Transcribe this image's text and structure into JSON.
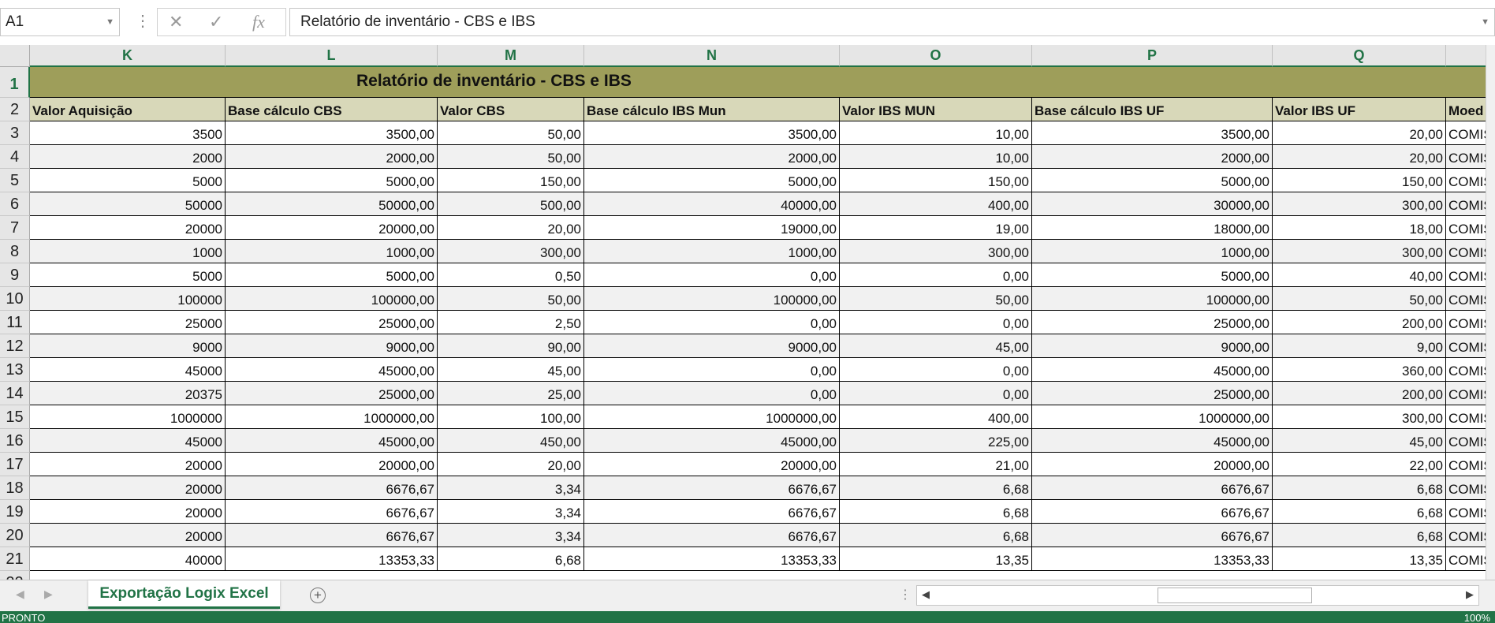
{
  "formula_bar": {
    "name_box": "A1",
    "cancel_icon": "✕",
    "enter_icon": "✓",
    "fx_label": "fx",
    "formula": "Relatório de inventário - CBS e IBS"
  },
  "columns": [
    "K",
    "L",
    "M",
    "N",
    "O",
    "P",
    "Q",
    ""
  ],
  "title": "Relatório de inventário - CBS e IBS",
  "headers": [
    "Valor Aquisição",
    "Base cálculo CBS",
    "Valor CBS",
    "Base cálculo IBS Mun",
    "Valor IBS MUN",
    "Base cálculo IBS UF",
    "Valor IBS UF",
    "Moed"
  ],
  "rows": [
    [
      "3500",
      "3500,00",
      "50,00",
      "3500,00",
      "10,00",
      "3500,00",
      "20,00",
      "COMIS"
    ],
    [
      "2000",
      "2000,00",
      "50,00",
      "2000,00",
      "10,00",
      "2000,00",
      "20,00",
      "COMIS"
    ],
    [
      "5000",
      "5000,00",
      "150,00",
      "5000,00",
      "150,00",
      "5000,00",
      "150,00",
      "COMIS"
    ],
    [
      "50000",
      "50000,00",
      "500,00",
      "40000,00",
      "400,00",
      "30000,00",
      "300,00",
      "COMIS"
    ],
    [
      "20000",
      "20000,00",
      "20,00",
      "19000,00",
      "19,00",
      "18000,00",
      "18,00",
      "COMIS"
    ],
    [
      "1000",
      "1000,00",
      "300,00",
      "1000,00",
      "300,00",
      "1000,00",
      "300,00",
      "COMIS"
    ],
    [
      "5000",
      "5000,00",
      "0,50",
      "0,00",
      "0,00",
      "5000,00",
      "40,00",
      "COMIS"
    ],
    [
      "100000",
      "100000,00",
      "50,00",
      "100000,00",
      "50,00",
      "100000,00",
      "50,00",
      "COMIS"
    ],
    [
      "25000",
      "25000,00",
      "2,50",
      "0,00",
      "0,00",
      "25000,00",
      "200,00",
      "COMIS"
    ],
    [
      "9000",
      "9000,00",
      "90,00",
      "9000,00",
      "45,00",
      "9000,00",
      "9,00",
      "COMIS"
    ],
    [
      "45000",
      "45000,00",
      "45,00",
      "0,00",
      "0,00",
      "45000,00",
      "360,00",
      "COMIS"
    ],
    [
      "20375",
      "25000,00",
      "25,00",
      "0,00",
      "0,00",
      "25000,00",
      "200,00",
      "COMIS"
    ],
    [
      "1000000",
      "1000000,00",
      "100,00",
      "1000000,00",
      "400,00",
      "1000000,00",
      "300,00",
      "COMIS"
    ],
    [
      "45000",
      "45000,00",
      "450,00",
      "45000,00",
      "225,00",
      "45000,00",
      "45,00",
      "COMIS"
    ],
    [
      "20000",
      "20000,00",
      "20,00",
      "20000,00",
      "21,00",
      "20000,00",
      "22,00",
      "COMIS"
    ],
    [
      "20000",
      "6676,67",
      "3,34",
      "6676,67",
      "6,68",
      "6676,67",
      "6,68",
      "COMIS"
    ],
    [
      "20000",
      "6676,67",
      "3,34",
      "6676,67",
      "6,68",
      "6676,67",
      "6,68",
      "COMIS"
    ],
    [
      "20000",
      "6676,67",
      "3,34",
      "6676,67",
      "6,68",
      "6676,67",
      "6,68",
      "COMIS"
    ],
    [
      "40000",
      "13353,33",
      "6,68",
      "13353,33",
      "13,35",
      "13353,33",
      "13,35",
      "COMIS"
    ]
  ],
  "sheet_tab": "Exportação Logix Excel",
  "status": {
    "ready": "PRONTO",
    "zoom": "100%"
  },
  "colors": {
    "excel_green": "#217346",
    "title_fill": "#9e9e5a",
    "header_fill": "#d8d8b9"
  }
}
